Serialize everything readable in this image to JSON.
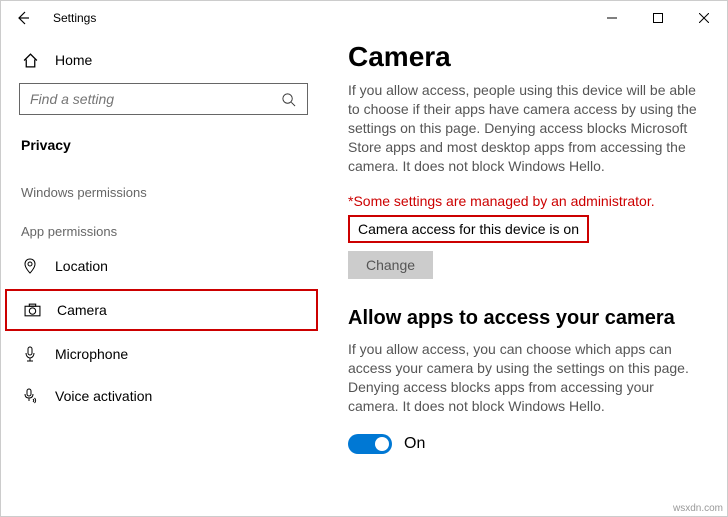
{
  "window": {
    "title": "Settings"
  },
  "sidebar": {
    "home_label": "Home",
    "search_placeholder": "Find a setting",
    "section_label": "Privacy",
    "group_windows_permissions": "Windows permissions",
    "group_app_permissions": "App permissions",
    "items": {
      "location": "Location",
      "camera": "Camera",
      "microphone": "Microphone",
      "voice_activation": "Voice activation"
    }
  },
  "content": {
    "title": "Camera",
    "description": "If you allow access, people using this device will be able to choose if their apps have camera access by using the settings on this page. Denying access blocks Microsoft Store apps and most desktop apps from accessing the camera. It does not block Windows Hello.",
    "admin_note": "*Some settings are managed by an administrator.",
    "device_access_status": "Camera access for this device is on",
    "change_button": "Change",
    "allow_apps_heading": "Allow apps to access your camera",
    "allow_apps_description": "If you allow access, you can choose which apps can access your camera by using the settings on this page. Denying access blocks apps from accessing your camera. It does not block Windows Hello.",
    "toggle_label": "On",
    "toggle_state": true
  },
  "watermark": "wsxdn.com"
}
